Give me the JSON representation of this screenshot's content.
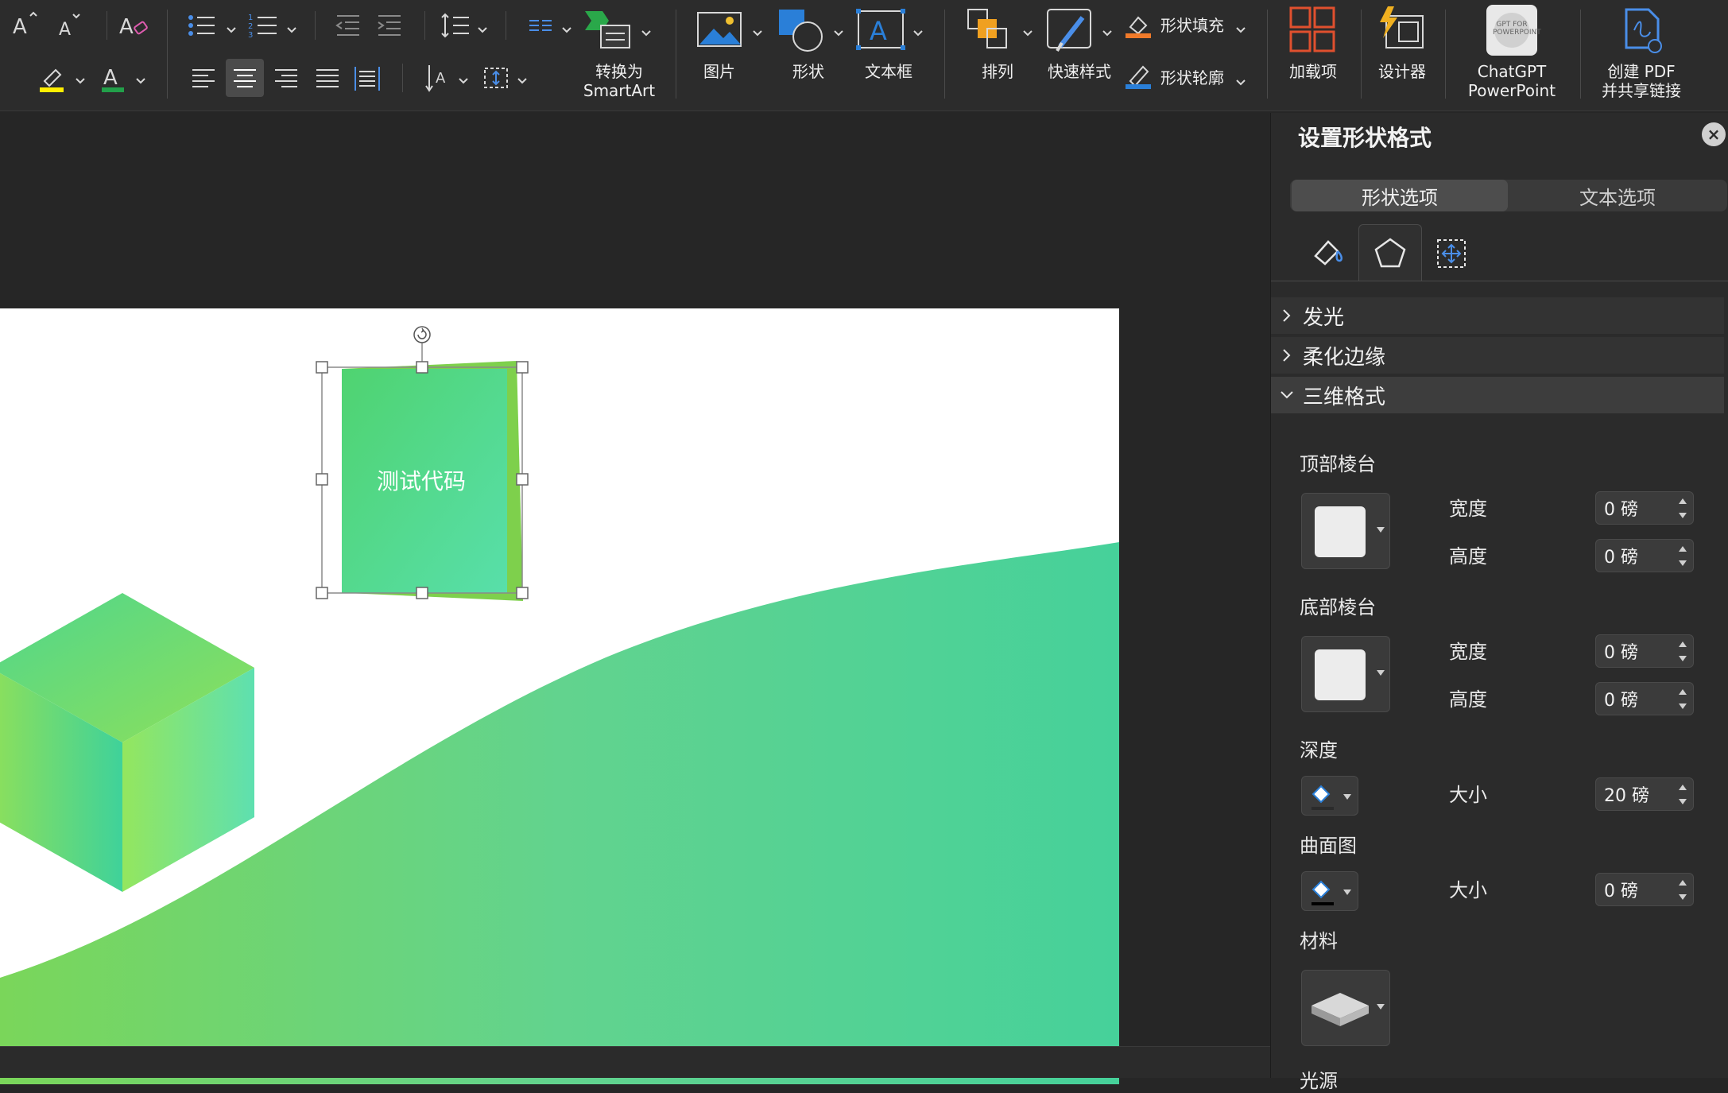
{
  "ribbon": {
    "convert_smartart_line1": "转换为",
    "convert_smartart_line2": "SmartArt",
    "picture": "图片",
    "shape": "形状",
    "textbox": "文本框",
    "arrange": "排列",
    "quick_styles": "快速样式",
    "shape_fill": "形状填充",
    "shape_outline": "形状轮廓",
    "addins": "加载项",
    "designer": "设计器",
    "chatgpt_line1": "ChatGPT",
    "chatgpt_line2": "PowerPoint",
    "chatgpt_logo_text": "GPT FOR POWERPOINT",
    "create_pdf_line1": "创建 PDF",
    "create_pdf_line2": "并共享链接"
  },
  "slide": {
    "textbox_text": "测试代码"
  },
  "pane": {
    "title": "设置形状格式",
    "tabs": [
      "形状选项",
      "文本选项"
    ],
    "active_tab": "形状选项",
    "sections": {
      "glow": "发光",
      "soft_edges": "柔化边缘",
      "three_d_format": "三维格式"
    },
    "top_bevel": {
      "label": "顶部棱台",
      "width_label": "宽度",
      "width_value": "0 磅",
      "height_label": "高度",
      "height_value": "0 磅"
    },
    "bottom_bevel": {
      "label": "底部棱台",
      "width_label": "宽度",
      "width_value": "0 磅",
      "height_label": "高度",
      "height_value": "0 磅"
    },
    "depth": {
      "label": "深度",
      "size_label": "大小",
      "size_value": "20 磅"
    },
    "contour": {
      "label": "曲面图",
      "size_label": "大小",
      "size_value": "0 磅"
    },
    "material": {
      "label": "材料"
    },
    "lighting": {
      "label": "光源"
    }
  },
  "colors": {
    "accent_green": "#46d19a",
    "lime": "#8ee05a",
    "highlight_yellow": "#ffee00",
    "font_color_green": "#22a04a",
    "shape_fill_orange": "#f07a2a",
    "outline_blue": "#2a7fd8",
    "addins_red": "#e0502e"
  }
}
